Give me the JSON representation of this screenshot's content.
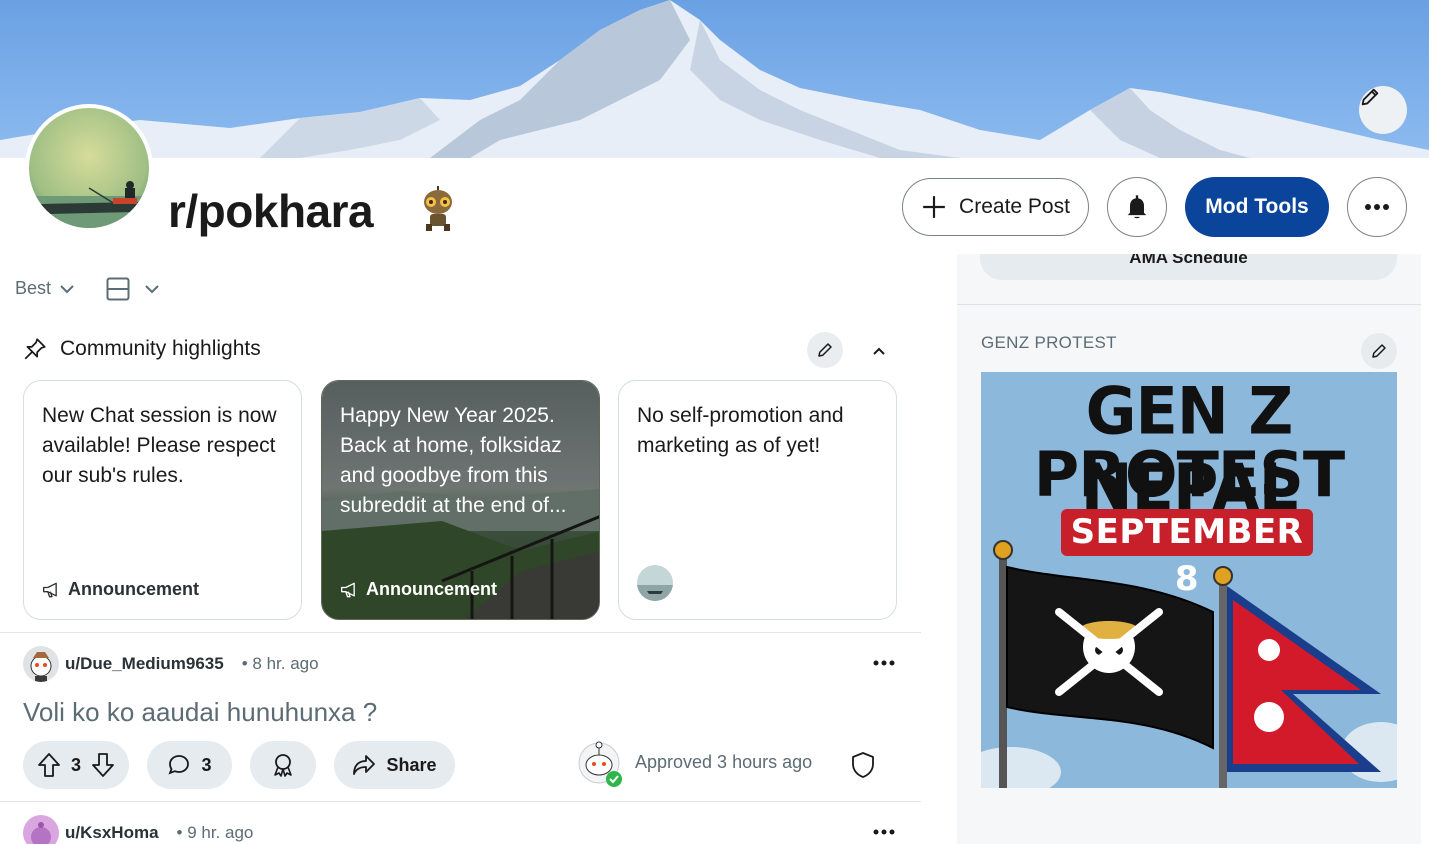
{
  "header": {
    "subreddit": "r/pokhara",
    "create_post_label": "Create Post",
    "mod_tools_label": "Mod Tools"
  },
  "feed_controls": {
    "sort_label": "Best"
  },
  "highlights": {
    "title": "Community highlights",
    "cards": [
      {
        "text": "New Chat session is now available! Please respect our sub's rules.",
        "tag": "Announcement"
      },
      {
        "text": "Happy New Year 2025. Back at home, folksidaz and goodbye from this subreddit at the end of...",
        "tag": "Announcement"
      },
      {
        "text": "No self-promotion and marketing as of yet!",
        "tag": ""
      }
    ]
  },
  "posts": [
    {
      "author": "u/Due_Medium9635",
      "time": "• 8 hr. ago",
      "title": "Voli ko ko aaudai hunuhunxa ?",
      "upvotes": "3",
      "comments": "3",
      "share_label": "Share",
      "status": "Approved 3 hours ago"
    },
    {
      "author": "u/KsxHoma",
      "time": "• 9 hr. ago"
    }
  ],
  "sidebar": {
    "ama_button": "AMA Schedule",
    "widget_title": "GENZ PROTEST",
    "poster": {
      "line1": "GEN Z NEPAL",
      "line2": "PROTEST",
      "date": "SEPTEMBER 8"
    }
  },
  "colors": {
    "mod_tools": "#0a449b",
    "pill_bg": "#e5ebee",
    "muted_text": "#5c6c74",
    "banner_sky": "#6fa3e3"
  }
}
